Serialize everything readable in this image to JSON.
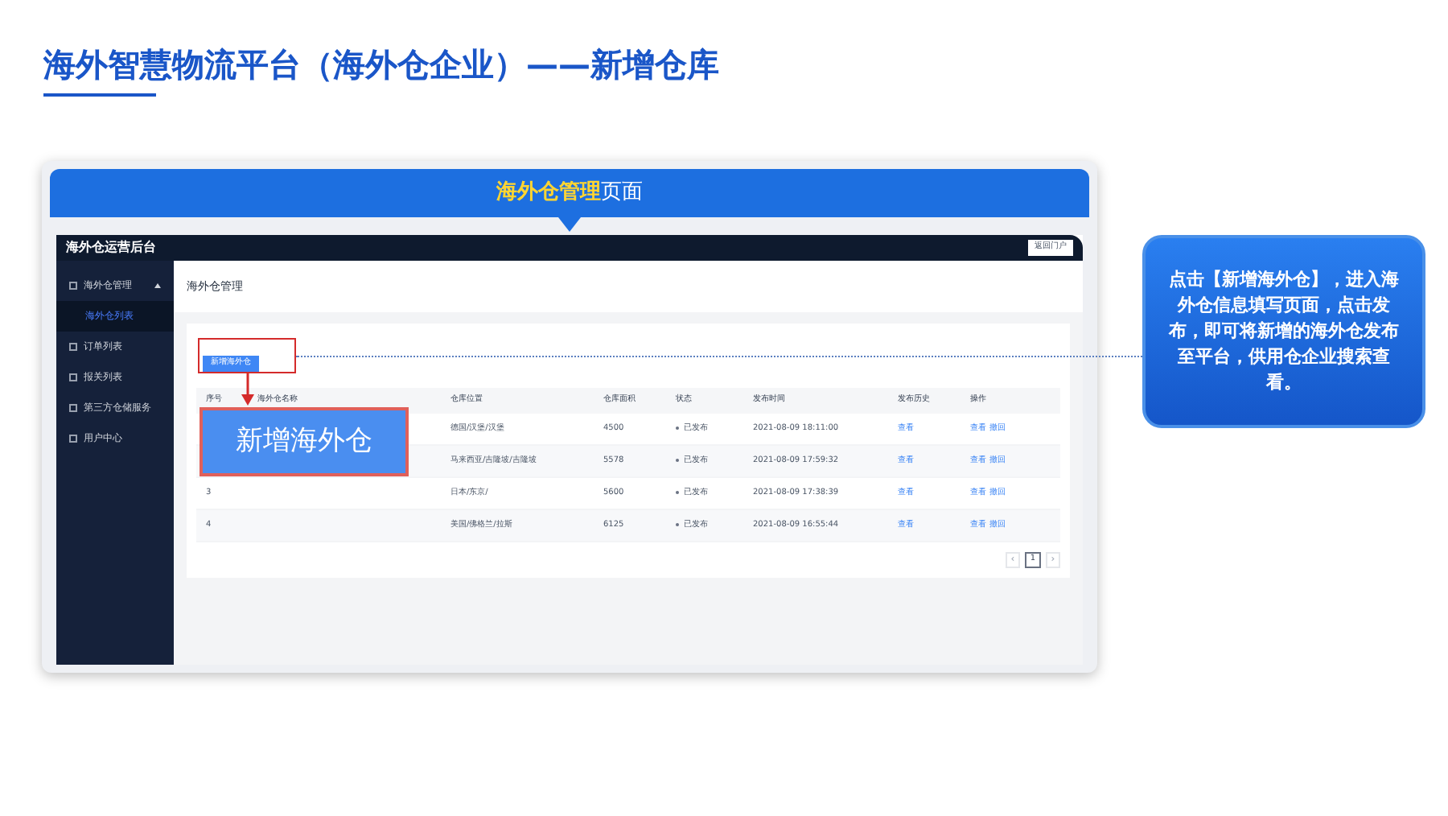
{
  "slide_title": "海外智慧物流平台（海外仓企业）——新增仓库",
  "banner": {
    "highlight": "海外仓管理",
    "rest": "页面"
  },
  "app": {
    "brand": "海外仓运营后台",
    "portal_button": "返回门户",
    "sidebar": [
      {
        "label": "海外仓管理",
        "expanded": true,
        "children": [
          {
            "label": "海外仓列表",
            "selected": true
          }
        ]
      },
      {
        "label": "订单列表",
        "expanded": false
      },
      {
        "label": "报关列表",
        "expanded": false
      },
      {
        "label": "第三方仓储服务",
        "expanded": false
      },
      {
        "label": "用户中心",
        "expanded": false
      }
    ],
    "page_title": "海外仓管理",
    "add_button": "新增海外仓",
    "table": {
      "columns": [
        "序号",
        "海外仓名称",
        "仓库位置",
        "仓库面积",
        "状态",
        "发布时间",
        "发布历史",
        "操作"
      ],
      "rows": [
        {
          "location": "德国/汉堡/汉堡",
          "area": "4500",
          "status": "已发布",
          "time": "2021-08-09 18:11:00",
          "history": "查看",
          "actions": [
            "查看",
            "撤回"
          ]
        },
        {
          "location": "马来西亚/吉隆坡/吉隆坡",
          "area": "5578",
          "status": "已发布",
          "time": "2021-08-09 17:59:32",
          "history": "查看",
          "actions": [
            "查看",
            "撤回"
          ]
        },
        {
          "serial": "3",
          "location": "日本/东京/",
          "area": "5600",
          "status": "已发布",
          "time": "2021-08-09 17:38:39",
          "history": "查看",
          "actions": [
            "查看",
            "撤回"
          ]
        },
        {
          "serial": "4",
          "location": "美国/佛格兰/拉斯",
          "area": "6125",
          "status": "已发布",
          "time": "2021-08-09 16:55:44",
          "history": "查看",
          "actions": [
            "查看",
            "撤回"
          ]
        }
      ]
    },
    "pagination": {
      "prev": "‹",
      "pages": [
        {
          "label": "1",
          "selected": true
        }
      ],
      "next": "›"
    }
  },
  "zoom_label": "新增海外仓",
  "callout": "点击【新增海外仓】，进入海外仓信息填写页面，点击发布，即可将新增的海外仓发布至平台，供用仓企业搜索查看。"
}
